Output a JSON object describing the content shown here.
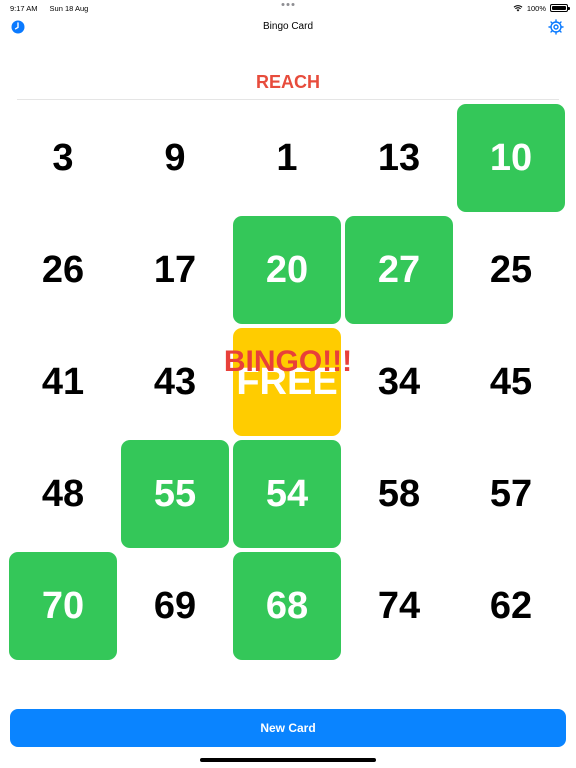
{
  "status_bar": {
    "time": "9:17 AM",
    "date": "Sun 18 Aug",
    "battery": "100%"
  },
  "nav": {
    "title": "Bingo Card",
    "left_icon": "history-clock-icon",
    "right_icon": "settings-gear-icon"
  },
  "status": {
    "label": "REACH",
    "color": "#e74c3c"
  },
  "grid": {
    "rows": [
      [
        {
          "value": "3",
          "state": "unmarked"
        },
        {
          "value": "9",
          "state": "unmarked"
        },
        {
          "value": "1",
          "state": "unmarked"
        },
        {
          "value": "13",
          "state": "unmarked"
        },
        {
          "value": "10",
          "state": "marked"
        }
      ],
      [
        {
          "value": "26",
          "state": "unmarked"
        },
        {
          "value": "17",
          "state": "unmarked"
        },
        {
          "value": "20",
          "state": "marked"
        },
        {
          "value": "27",
          "state": "marked"
        },
        {
          "value": "25",
          "state": "unmarked"
        }
      ],
      [
        {
          "value": "41",
          "state": "unmarked"
        },
        {
          "value": "43",
          "state": "unmarked"
        },
        {
          "value": "FREE",
          "state": "free"
        },
        {
          "value": "34",
          "state": "unmarked"
        },
        {
          "value": "45",
          "state": "unmarked"
        }
      ],
      [
        {
          "value": "48",
          "state": "unmarked"
        },
        {
          "value": "55",
          "state": "marked"
        },
        {
          "value": "54",
          "state": "marked"
        },
        {
          "value": "58",
          "state": "unmarked"
        },
        {
          "value": "57",
          "state": "unmarked"
        }
      ],
      [
        {
          "value": "70",
          "state": "marked"
        },
        {
          "value": "69",
          "state": "unmarked"
        },
        {
          "value": "68",
          "state": "marked"
        },
        {
          "value": "74",
          "state": "unmarked"
        },
        {
          "value": "62",
          "state": "unmarked"
        }
      ]
    ],
    "marked_color": "#34c759",
    "free_color": "#ffcc00"
  },
  "overlay": {
    "bingo_text": "BINGO!!!",
    "color": "#e8403a"
  },
  "footer": {
    "new_card_label": "New Card",
    "button_color": "#0a84ff"
  }
}
